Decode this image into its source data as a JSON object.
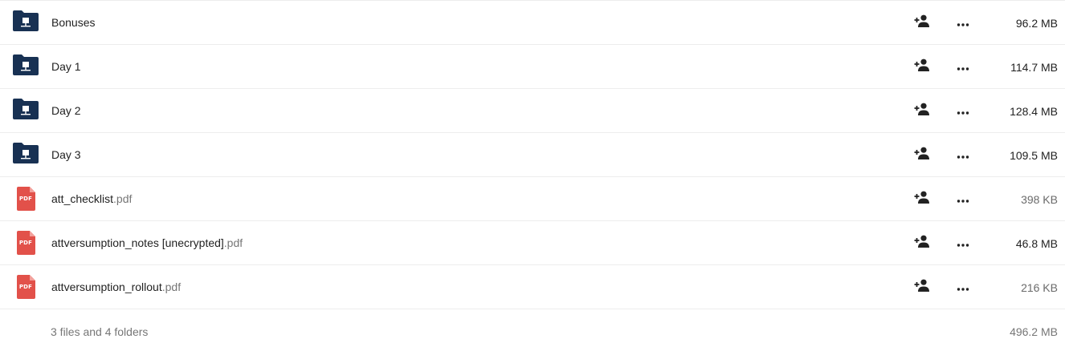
{
  "colors": {
    "folder": "#183153",
    "pdf": "#e2514a",
    "text": "#222222",
    "muted": "#767676",
    "divider": "#ededed"
  },
  "icons": {
    "folder": "network-folder-icon",
    "pdf": "pdf-icon",
    "share": "add-person-icon",
    "more": "more-horizontal-icon"
  },
  "pdf_badge_text": "PDF",
  "files": [
    {
      "name": "Bonuses",
      "ext": "",
      "type": "folder",
      "size": "96.2 MB"
    },
    {
      "name": "Day 1",
      "ext": "",
      "type": "folder",
      "size": "114.7 MB"
    },
    {
      "name": "Day 2",
      "ext": "",
      "type": "folder",
      "size": "128.4 MB"
    },
    {
      "name": "Day 3",
      "ext": "",
      "type": "folder",
      "size": "109.5 MB"
    },
    {
      "name": "att_checklist",
      "ext": ".pdf",
      "type": "pdf",
      "size": "398 KB"
    },
    {
      "name": "attversumption_notes [unecrypted]",
      "ext": ".pdf",
      "type": "pdf",
      "size": "46.8 MB"
    },
    {
      "name": "attversumption_rollout",
      "ext": ".pdf",
      "type": "pdf",
      "size": "216 KB"
    }
  ],
  "summary": {
    "label": "3 files and 4 folders",
    "total_size": "496.2 MB"
  }
}
